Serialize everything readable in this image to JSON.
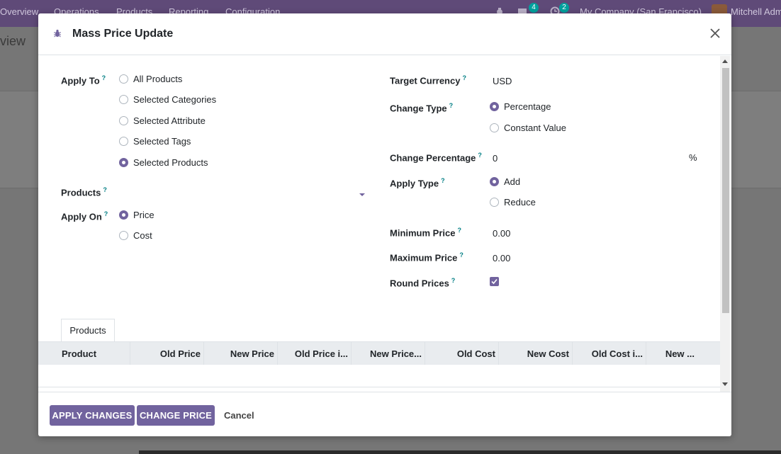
{
  "topbar": {
    "nav": [
      "Overview",
      "Operations",
      "Products",
      "Reporting",
      "Configuration"
    ],
    "chat_count": "4",
    "activity_count": "2",
    "company": "My Company (San Francisco)",
    "user": "Mitchell Adm",
    "colors": {
      "bar": "#5f4a78",
      "badge": "#00a09d"
    }
  },
  "background": {
    "breadcrumb": "view"
  },
  "dialog": {
    "title": "Mass Price Update",
    "icon": "bug-icon",
    "left": {
      "apply_to_label": "Apply To",
      "apply_to_options": [
        {
          "label": "All Products",
          "selected": false
        },
        {
          "label": "Selected Categories",
          "selected": false
        },
        {
          "label": "Selected Attribute",
          "selected": false
        },
        {
          "label": "Selected Tags",
          "selected": false
        },
        {
          "label": "Selected Products",
          "selected": true
        }
      ],
      "products_label": "Products",
      "products_value": "",
      "apply_on_label": "Apply On",
      "apply_on_options": [
        {
          "label": "Price",
          "selected": true
        },
        {
          "label": "Cost",
          "selected": false
        }
      ]
    },
    "right": {
      "target_currency_label": "Target Currency",
      "target_currency_value": "USD",
      "change_type_label": "Change Type",
      "change_type_options": [
        {
          "label": "Percentage",
          "selected": true
        },
        {
          "label": "Constant Value",
          "selected": false
        }
      ],
      "change_percentage_label": "Change Percentage",
      "change_percentage_value": "0",
      "percent_symbol": "%",
      "apply_type_label": "Apply Type",
      "apply_type_options": [
        {
          "label": "Add",
          "selected": true
        },
        {
          "label": "Reduce",
          "selected": false
        }
      ],
      "minimum_price_label": "Minimum Price",
      "minimum_price_value": "0.00",
      "maximum_price_label": "Maximum Price",
      "maximum_price_value": "0.00",
      "round_prices_label": "Round Prices",
      "round_prices_checked": true
    },
    "help_mark": "?",
    "tab_label": "Products",
    "table_columns": [
      "Product",
      "Old Price",
      "New Price",
      "Old Price i...",
      "New Price...",
      "Old Cost",
      "New Cost",
      "Old Cost i...",
      "New ..."
    ],
    "footer": {
      "apply_changes": "APPLY CHANGES",
      "change_price": "CHANGE PRICE",
      "cancel": "Cancel"
    },
    "accent_color": "#71639e"
  }
}
